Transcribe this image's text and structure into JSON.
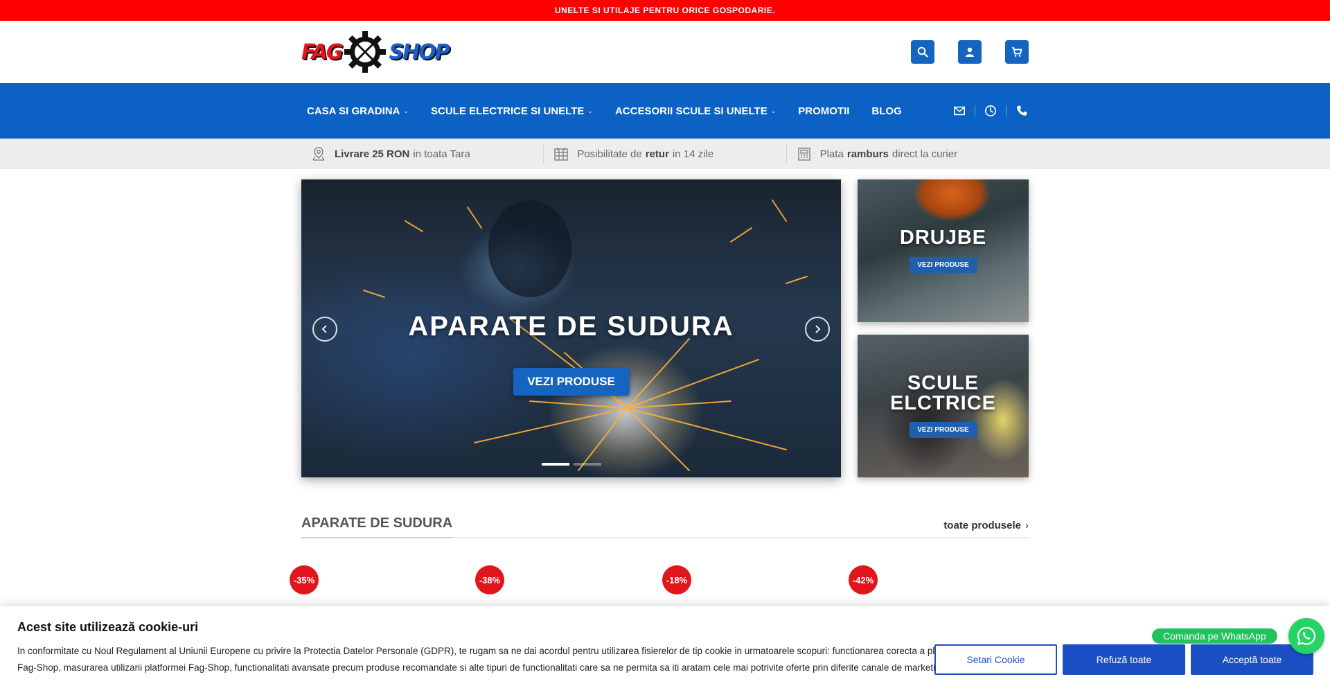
{
  "topbar": {
    "text": "UNELTE SI UTILAJE PENTRU ORICE GOSPODARIE."
  },
  "logo": {
    "text_left": "FAG",
    "text_right": "SHOP"
  },
  "header": {
    "icons": [
      "search-icon",
      "user-icon",
      "cart-icon"
    ]
  },
  "nav": {
    "items": [
      {
        "label": "CASA SI GRADINA",
        "dropdown": true
      },
      {
        "label": "SCULE ELECTRICE SI UNELTE",
        "dropdown": true
      },
      {
        "label": "ACCESORII SCULE SI UNELTE",
        "dropdown": true
      },
      {
        "label": "PROMOTII",
        "dropdown": false
      },
      {
        "label": "BLOG",
        "dropdown": false
      }
    ],
    "icons": [
      "mail-icon",
      "clock-icon",
      "phone-icon"
    ]
  },
  "benefits": [
    {
      "bold": "Livrare 25 RON",
      "text": "in toata Tara"
    },
    {
      "pre": "Posibilitate de",
      "bold": "retur",
      "post": "in 14 zile"
    },
    {
      "pre": "Plata",
      "bold": "ramburs",
      "post": "direct la curier"
    }
  ],
  "slider": {
    "title": "APARATE DE SUDURA",
    "button": "VEZI PRODUSE",
    "dots": 2,
    "active_dot": 1
  },
  "banners": [
    {
      "title": "DRUJBE",
      "button": "VEZI PRODUSE"
    },
    {
      "title_line1": "SCULE",
      "title_line2": "ELCTRICE",
      "button": "VEZI PRODUSE"
    }
  ],
  "section": {
    "title": "APARATE DE SUDURA",
    "link": "toate produsele"
  },
  "product_badges": [
    "-35%",
    "-38%",
    "-18%",
    "-42%"
  ],
  "cookie": {
    "title": "Acest site utilizează cookie-uri",
    "text": "In conformitate cu Noul Regulament al Uniunii Europene cu privire la Protectia Datelor Personale (GDPR), te rugam sa ne dai acordul pentru utilizarea fisierelor de tip cookie in urmatoarele scopuri: functionarea corecta a platformei Fag-Shop, masurarea utilizarii platformei Fag-Shop, functionalitati avansate precum produse recomandate si alte tipuri de functionalitati care sa ne permita sa iti aratam cele mai potrivite oferte prin diferite canale de marketing.",
    "buttons": {
      "settings": "Setari Cookie",
      "reject": "Refuză toate",
      "accept": "Acceptă toate"
    }
  },
  "whatsapp": {
    "label": "Comanda pe WhatsApp"
  },
  "colors": {
    "topbar": "#ff0000",
    "nav": "#0b61c4",
    "accent": "#1565c0",
    "cookie_button": "#1d4fc4",
    "whatsapp": "#25d366"
  }
}
